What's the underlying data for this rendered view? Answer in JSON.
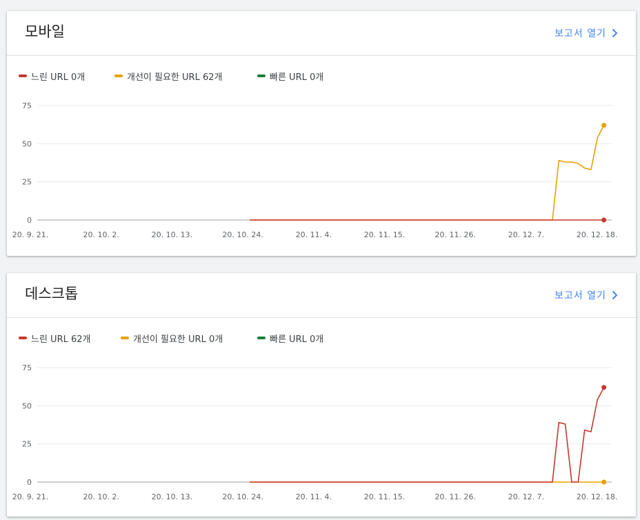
{
  "colors": {
    "slow": "#c5372c",
    "needs_improvement": "#e8a000",
    "fast": "#188038",
    "link": "#4285f4",
    "grid": "#e8eaed",
    "axis": "#9aa0a6"
  },
  "report_link_label": "보고서 열기",
  "cards": [
    {
      "title": "모바일",
      "legend": [
        {
          "label": "느린 URL 0개",
          "series": "slow"
        },
        {
          "label": "개선이 필요한 URL 62개",
          "series": "needs_improvement"
        },
        {
          "label": "빠른 URL 0개",
          "series": "fast"
        }
      ]
    },
    {
      "title": "데스크톱",
      "legend": [
        {
          "label": "느린 URL 62개",
          "series": "slow"
        },
        {
          "label": "개선이 필요한 URL 0개",
          "series": "needs_improvement"
        },
        {
          "label": "빠른 URL 0개",
          "series": "fast"
        }
      ]
    }
  ],
  "chart_data": [
    {
      "type": "line",
      "ylim": [
        0,
        75
      ],
      "yticks": [
        0,
        25,
        50,
        75
      ],
      "xlim": [
        0,
        89
      ],
      "xticks": [
        {
          "x": 0,
          "label": "20. 9. 21."
        },
        {
          "x": 11,
          "label": "20. 10. 2."
        },
        {
          "x": 22,
          "label": "20. 10. 13."
        },
        {
          "x": 33,
          "label": "20. 10. 24."
        },
        {
          "x": 44,
          "label": "20. 11. 4."
        },
        {
          "x": 55,
          "label": "20. 11. 15."
        },
        {
          "x": 66,
          "label": "20. 11. 26."
        },
        {
          "x": 77,
          "label": "20. 12. 7."
        },
        {
          "x": 88,
          "label": "20. 12. 18."
        }
      ],
      "series": [
        {
          "key": "needs_improvement",
          "points": [
            [
              33,
              0
            ],
            [
              80,
              0
            ],
            [
              81,
              39
            ],
            [
              82,
              38
            ],
            [
              83,
              38
            ],
            [
              84,
              37
            ],
            [
              85,
              34
            ],
            [
              86,
              33
            ],
            [
              87,
              54
            ],
            [
              88,
              62
            ]
          ],
          "end_marker": true
        },
        {
          "key": "slow",
          "points": [
            [
              33,
              0
            ],
            [
              88,
              0
            ]
          ],
          "end_marker": true
        }
      ]
    },
    {
      "type": "line",
      "ylim": [
        0,
        75
      ],
      "yticks": [
        0,
        25,
        50,
        75
      ],
      "xlim": [
        0,
        89
      ],
      "xticks": [
        {
          "x": 0,
          "label": "20. 9. 21."
        },
        {
          "x": 11,
          "label": "20. 10. 2."
        },
        {
          "x": 22,
          "label": "20. 10. 13."
        },
        {
          "x": 33,
          "label": "20. 10. 24."
        },
        {
          "x": 44,
          "label": "20. 11. 4."
        },
        {
          "x": 55,
          "label": "20. 11. 15."
        },
        {
          "x": 66,
          "label": "20. 11. 26."
        },
        {
          "x": 77,
          "label": "20. 12. 7."
        },
        {
          "x": 88,
          "label": "20. 12. 18."
        }
      ],
      "series": [
        {
          "key": "needs_improvement",
          "points": [
            [
              33,
              0
            ],
            [
              88,
              0
            ]
          ],
          "end_marker": true
        },
        {
          "key": "slow",
          "points": [
            [
              33,
              0
            ],
            [
              80,
              0
            ],
            [
              81,
              39
            ],
            [
              82,
              38
            ],
            [
              83,
              0
            ],
            [
              84,
              0
            ],
            [
              85,
              34
            ],
            [
              86,
              33
            ],
            [
              87,
              54
            ],
            [
              88,
              62
            ]
          ],
          "end_marker": true
        }
      ]
    }
  ]
}
